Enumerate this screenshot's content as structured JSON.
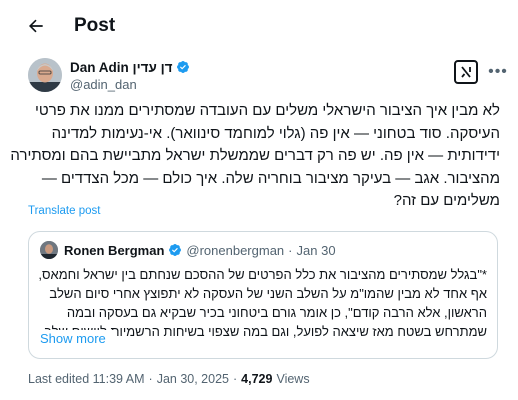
{
  "header": {
    "title": "Post"
  },
  "author": {
    "display_name": "Dan Adin דן עדין",
    "handle": "@adin_dan"
  },
  "tweet_lines": [
    "לא מבין איך הציבור הישראלי משלים עם העובדה שמסתירים ממנו את פרטי",
    "העיסקה. סוד בטחוני — אין פה (גלוי למוחמד סינוואר). אי-נעימות למדינה",
    "ידידותית — אין פה. יש פה רק דברים שממשלת ישראל מתביישת בהם ומסתירה",
    "מהציבור. אגב — בעיקר מציבור בוחריה שלה. איך כולם — מכל הצדדים —",
    "משלימים עם זה?"
  ],
  "translate_label": "Translate post",
  "quote": {
    "name": "Ronen Bergman",
    "handle": "@ronenbergman",
    "separator": "·",
    "date": "Jan 30",
    "lines": [
      "*\"בגלל שמסתירים מהציבור את כלל הפרטים של ההסכם שנחתם בין ישראל וחמאס,",
      "אף אחד לא מבין שהמו\"מ על השלב השני של העסקה לא יתפוצץ אחרי סיום השלב",
      "הראשון, אלא הרבה קודם\", כן אומר גורם ביטחוני בכיר שבקיא גם בעסקה ובמה",
      "שמתרחש בשטח מאז שיצאה לפועל, וגם במה שצפוי בשיחות הרשמיות ליישום שלב"
    ],
    "show_more": "Show more"
  },
  "meta": {
    "edited": "Last edited 11:39 AM",
    "separator": "·",
    "date": "Jan 30, 2025",
    "views_count": "4,729",
    "views_label": "Views"
  },
  "colors": {
    "accent": "#1d9bf0",
    "text_primary": "#0f1419",
    "text_secondary": "#536471",
    "border": "#cfd9de"
  },
  "icons": {
    "back": "arrow-left-icon",
    "verified": "verified-badge-icon",
    "grok": "grok-icon",
    "more": "more-options-icon"
  }
}
